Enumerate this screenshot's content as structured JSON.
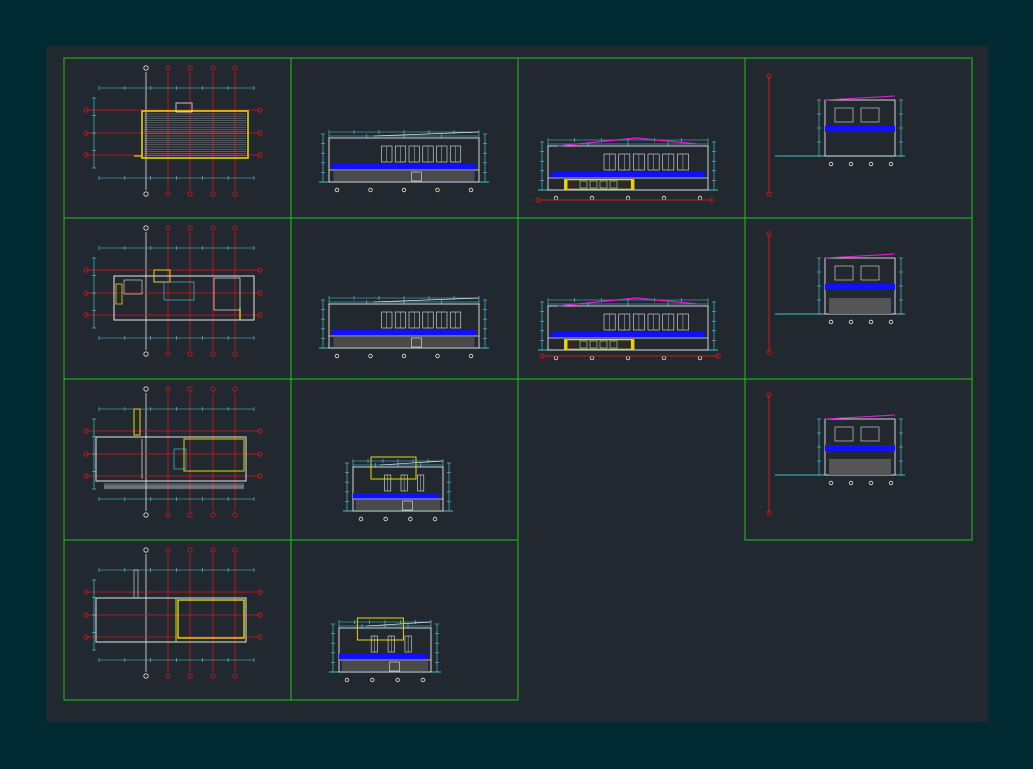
{
  "canvas": {
    "background": "#022a32",
    "sheet_background": "#212830"
  },
  "colors": {
    "frame": "#19c619",
    "grid_line": "#d01818",
    "grid_bubble": "#d01818",
    "wall": "#e6e6e6",
    "dimension": "#4fd3e0",
    "floor_slab": "#1010ff",
    "highlight": "#e6d30a",
    "roof_accent": "#e020d0",
    "ground": "#39c6c6"
  },
  "panels": [
    {
      "id": "plan-roof",
      "kind": "plan",
      "variant": "roof"
    },
    {
      "id": "elev-1",
      "kind": "elevation",
      "variant": "long-a"
    },
    {
      "id": "sect-1",
      "kind": "section",
      "variant": "long-roof"
    },
    {
      "id": "elev-side-1",
      "kind": "elevation",
      "variant": "short-a"
    },
    {
      "id": "plan-upper",
      "kind": "plan",
      "variant": "upper"
    },
    {
      "id": "elev-2",
      "kind": "elevation",
      "variant": "long-b"
    },
    {
      "id": "sect-2",
      "kind": "section",
      "variant": "long-stair"
    },
    {
      "id": "elev-side-2",
      "kind": "elevation",
      "variant": "short-b"
    },
    {
      "id": "plan-ground",
      "kind": "plan",
      "variant": "ground"
    },
    {
      "id": "elev-3",
      "kind": "elevation",
      "variant": "short-c"
    },
    {
      "id": "sect-3",
      "kind": "section",
      "variant": "short-d"
    },
    {
      "id": "plan-foundation",
      "kind": "plan",
      "variant": "foundation"
    },
    {
      "id": "elev-4",
      "kind": "elevation",
      "variant": "short-e"
    }
  ]
}
